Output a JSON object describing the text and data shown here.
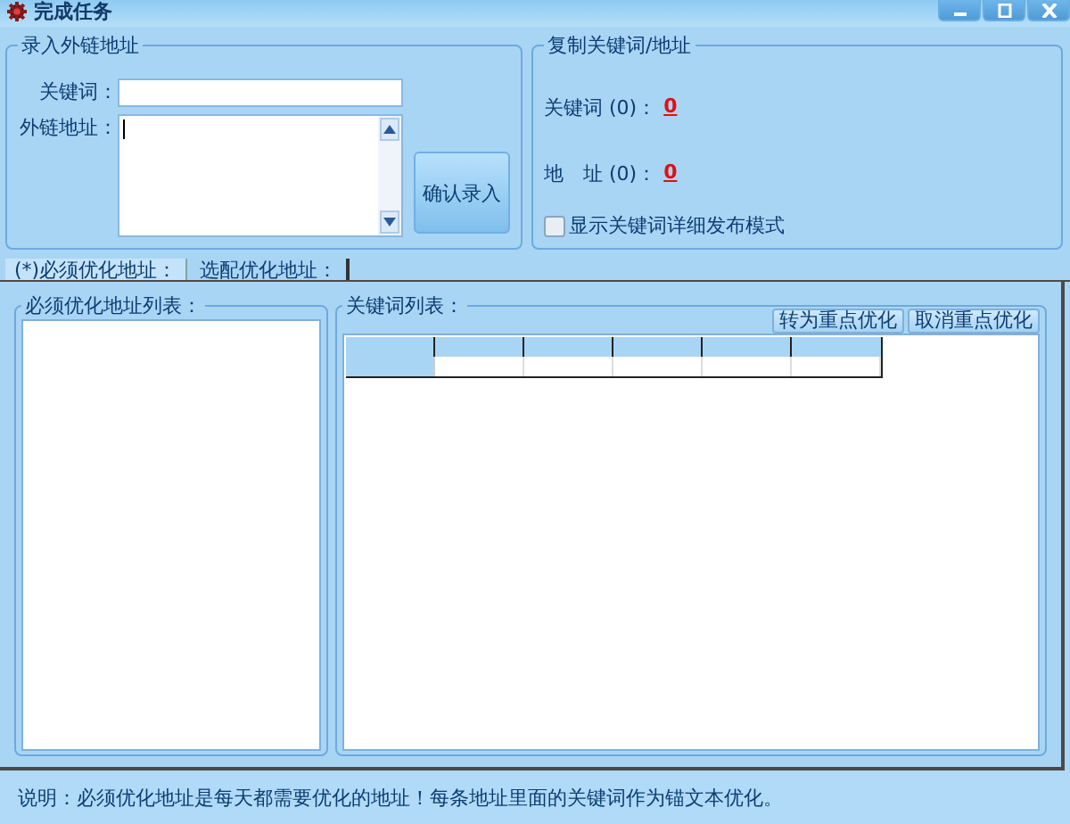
{
  "window": {
    "title": "完成任务"
  },
  "input_group": {
    "title": "录入外链地址",
    "fields": [
      {
        "label": "关键词：",
        "kind": "line"
      },
      {
        "label": "外链地址：",
        "kind": "area"
      }
    ],
    "button": "确认录入"
  },
  "copy_group": {
    "title": "复制关键词/地址",
    "counts": [
      {
        "label": "关键词 (0)：",
        "value": "0"
      },
      {
        "label": "地　址 (0)：",
        "value": "0"
      }
    ],
    "checkbox": {
      "label": "显示关键词详细发布模式",
      "checked": false
    }
  },
  "tabs": [
    {
      "label": "(*)必须优化地址：",
      "selected": true
    },
    {
      "label": "选配优化地址：",
      "selected": false
    }
  ],
  "address_list": {
    "title": "必须优化地址列表："
  },
  "keyword_list": {
    "title": "关键词列表：",
    "buttons": [
      "转为重点优化",
      "取消重点优化"
    ]
  },
  "status_bar": "说明：必须优化地址是每天都需要优化的地址！每条地址里面的关键词作为锚文本优化。"
}
